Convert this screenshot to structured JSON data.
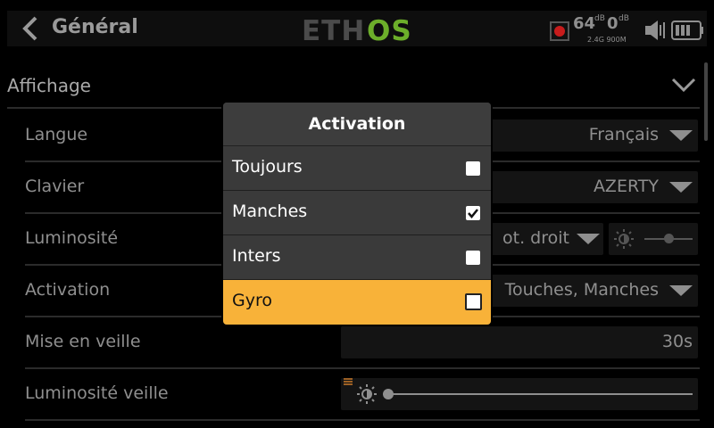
{
  "header": {
    "title": "Général",
    "logo_text": "ETHOS",
    "rssi_24": "64",
    "rssi_24_unit": "dB",
    "rssi_900": "0",
    "rssi_900_unit": "dB",
    "band_labels": "2.4G 900M"
  },
  "section": {
    "title": "Affichage"
  },
  "rows": [
    {
      "label": "Langue",
      "value": "Français"
    },
    {
      "label": "Clavier",
      "value": "AZERTY"
    },
    {
      "label": "Luminosité",
      "value": "ot. droit"
    },
    {
      "label": "Activation",
      "value": "Touches, Manches"
    },
    {
      "label": "Mise en veille",
      "value": "30s"
    },
    {
      "label": "Luminosité veille",
      "value": ""
    }
  ],
  "dialog": {
    "title": "Activation",
    "options": [
      {
        "label": "Toujours",
        "checked": false
      },
      {
        "label": "Manches",
        "checked": true
      },
      {
        "label": "Inters",
        "checked": false
      },
      {
        "label": "Gyro",
        "checked": false,
        "highlighted": true
      }
    ]
  },
  "colors": {
    "accent": "#f8b239",
    "logo_green": "#6cae2a",
    "rec_red": "#c81c1c"
  }
}
